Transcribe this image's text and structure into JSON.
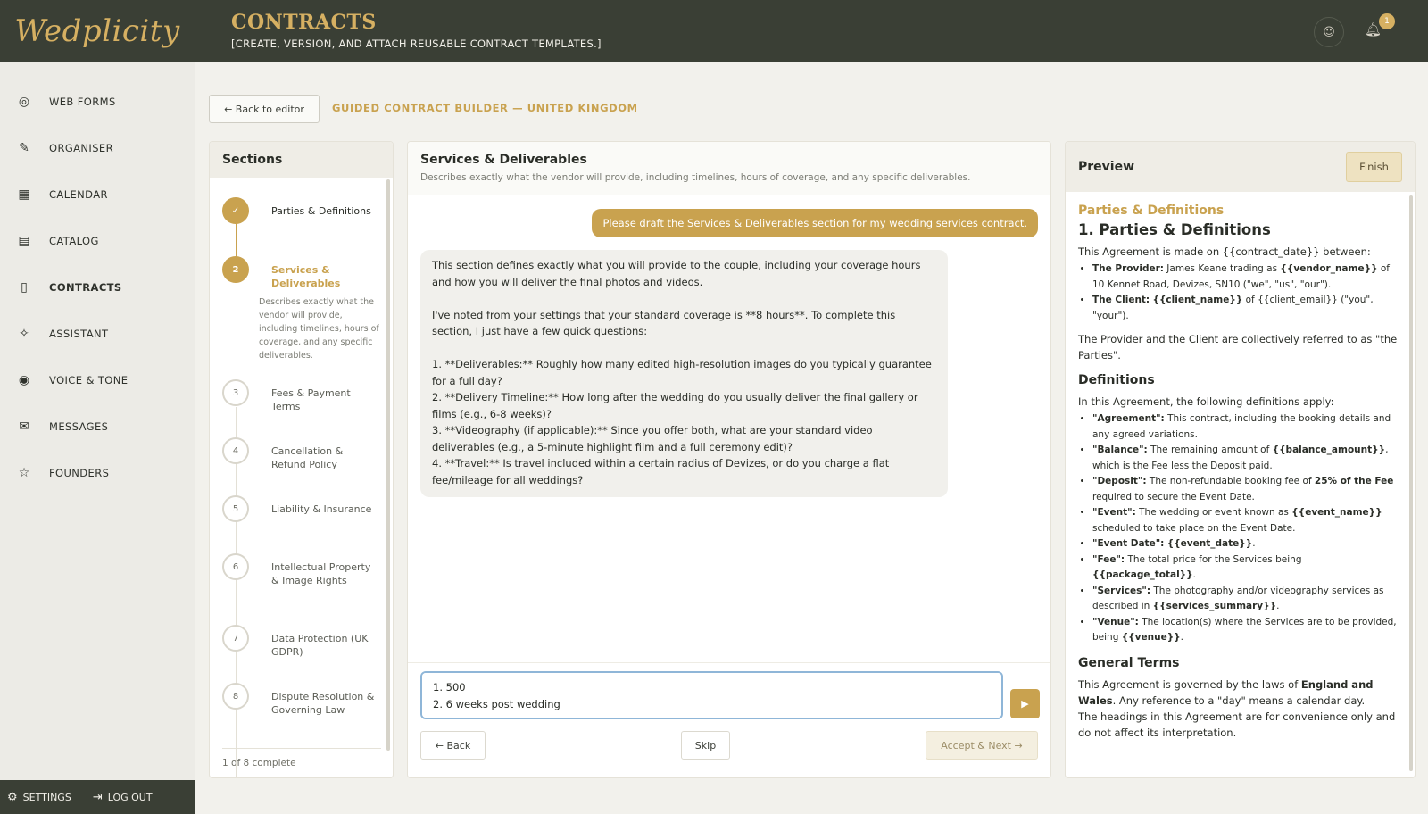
{
  "logo": "Wedplicity",
  "header": {
    "title": "CONTRACTS",
    "subtitle": "[CREATE, VERSION, AND ATTACH REUSABLE CONTRACT TEMPLATES.]",
    "notification_count": "1"
  },
  "nav": {
    "items": [
      {
        "label": "WEB FORMS",
        "icon": "globe-icon"
      },
      {
        "label": "ORGANISER",
        "icon": "pencil-icon"
      },
      {
        "label": "CALENDAR",
        "icon": "calendar-icon"
      },
      {
        "label": "CATALOG",
        "icon": "book-icon"
      },
      {
        "label": "CONTRACTS",
        "icon": "document-icon"
      },
      {
        "label": "ASSISTANT",
        "icon": "sparkle-icon"
      },
      {
        "label": "VOICE & TONE",
        "icon": "voice-icon"
      },
      {
        "label": "MESSAGES",
        "icon": "mail-icon"
      },
      {
        "label": "FOUNDERS",
        "icon": "star-icon"
      }
    ],
    "settings": "SETTINGS",
    "logout": "LOG OUT"
  },
  "toolbar": {
    "back_editor": "← Back to editor",
    "guided_title": "GUIDED CONTRACT BUILDER — UNITED KINGDOM"
  },
  "sections": {
    "title": "Sections",
    "steps": [
      {
        "num": "✓",
        "title": "Parties & Definitions",
        "state": "done"
      },
      {
        "num": "2",
        "title": "Services & Deliverables",
        "state": "current",
        "desc": "Describes exactly what the vendor will provide, including timelines, hours of coverage, and any specific deliverables."
      },
      {
        "num": "3",
        "title": "Fees & Payment Terms",
        "state": "pending"
      },
      {
        "num": "4",
        "title": "Cancellation & Refund Policy",
        "state": "pending"
      },
      {
        "num": "5",
        "title": "Liability & Insurance",
        "state": "pending"
      },
      {
        "num": "6",
        "title": "Intellectual Property & Image Rights",
        "state": "pending"
      },
      {
        "num": "7",
        "title": "Data Protection (UK GDPR)",
        "state": "pending"
      },
      {
        "num": "8",
        "title": "Dispute Resolution & Governing Law",
        "state": "pending"
      }
    ],
    "progress": "1 of 8 complete"
  },
  "chat": {
    "title": "Services & Deliverables",
    "description": "Describes exactly what the vendor will provide, including timelines, hours of coverage, and any specific deliverables.",
    "user_message": "Please draft the Services & Deliverables section for my wedding services contract.",
    "assistant_message": "This section defines exactly what you will provide to the couple, including your coverage hours and how you will deliver the final photos and videos.\n\nI've noted from your settings that your standard coverage is **8 hours**. To complete this section, I just have a few quick questions:\n\n1. **Deliverables:** Roughly how many edited high-resolution images do you typically guarantee for a full day?\n2. **Delivery Timeline:** How long after the wedding do you usually deliver the final gallery or films (e.g., 6-8 weeks)?\n3. **Videography (if applicable):** Since you offer both, what are your standard video deliverables (e.g., a 5-minute highlight film and a full ceremony edit)?\n4. **Travel:** Is travel included within a certain radius of Devizes, or do you charge a flat fee/mileage for all weddings?",
    "reply_value": "1. 500\n2. 6 weeks post wedding",
    "back": "← Back",
    "skip": "Skip",
    "accept": "Accept & Next →"
  },
  "preview": {
    "title": "Preview",
    "finish": "Finish",
    "section_title": "Parties & Definitions",
    "heading": "1. Parties & Definitions",
    "intro": "This Agreement is made on {{contract_date}} between:",
    "parties": [
      {
        "k": "The Provider:",
        "v": " James Keane trading as ",
        "b": "{{vendor_name}}",
        "v2": " of 10 Kennet Road, Devizes, SN10 (\"we\", \"us\", \"our\")."
      },
      {
        "k": "The Client:",
        "v": " ",
        "b": "{{client_name}}",
        "v2": " of {{client_email}} (\"you\", \"your\")."
      }
    ],
    "collective": "The Provider and the Client are collectively referred to as \"the Parties\".",
    "definitions_heading": "Definitions",
    "definitions_intro": "In this Agreement, the following definitions apply:",
    "definitions": [
      {
        "k": "\"Agreement\":",
        "v": " This contract, including the booking details and any agreed variations.",
        "b": "",
        "v2": ""
      },
      {
        "k": "\"Balance\":",
        "v": " The remaining amount of ",
        "b": "{{balance_amount}}",
        "v2": ", which is the Fee less the Deposit paid."
      },
      {
        "k": "\"Deposit\":",
        "v": " The non-refundable booking fee of ",
        "b": "25% of the Fee",
        "v2": " required to secure the Event Date."
      },
      {
        "k": "\"Event\":",
        "v": " The wedding or event known as ",
        "b": "{{event_name}}",
        "v2": " scheduled to take place on the Event Date."
      },
      {
        "k": "\"Event Date\":",
        "v": " ",
        "b": "{{event_date}}",
        "v2": "."
      },
      {
        "k": "\"Fee\":",
        "v": " The total price for the Services being ",
        "b": "{{package_total}}",
        "v2": "."
      },
      {
        "k": "\"Services\":",
        "v": " The photography and/or videography services as described in ",
        "b": "{{services_summary}}",
        "v2": "."
      },
      {
        "k": "\"Venue\":",
        "v": " The location(s) where the Services are to be provided, being ",
        "b": "{{venue}}",
        "v2": "."
      }
    ],
    "general_heading": "General Terms",
    "general_p1_a": "This Agreement is governed by the laws of ",
    "general_p1_b": "England and Wales",
    "general_p1_c": ". Any reference to a \"day\" means a calendar day.",
    "general_p2": "The headings in this Agreement are for convenience only and do not affect its interpretation."
  }
}
